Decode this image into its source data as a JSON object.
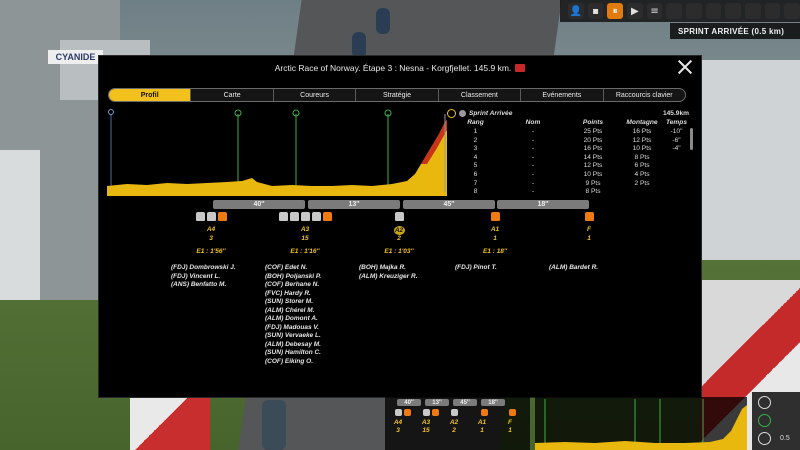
{
  "background": {
    "sign_text": "CYANIDE"
  },
  "hud": {
    "status_text": "SPRINT ARRIVÉE (0.5 km)",
    "buttons": [
      "👤",
      "▪",
      "⏸",
      "▶",
      "≡"
    ]
  },
  "modal": {
    "title": "Arctic Race of Norway. Étape 3 : Nesna - Korgfjellet. 145.9 km.",
    "tabs": [
      "Profil",
      "Carte",
      "Coureurs",
      "Stratégie",
      "Classement",
      "Evénements",
      "Raccourcis clavier"
    ],
    "active_tab": "Profil"
  },
  "sprint": {
    "label": "Sprint Arrivée",
    "distance": "145.9km",
    "headers": {
      "rank": "Rang",
      "name": "Nom",
      "points": "Points",
      "mountain": "Montagne",
      "time": "Temps"
    },
    "rows": [
      {
        "rank": "1",
        "name": "-",
        "points": "25 Pts",
        "mountain": "16 Pts",
        "time": "-10\""
      },
      {
        "rank": "2",
        "name": "-",
        "points": "20 Pts",
        "mountain": "12 Pts",
        "time": "-6\""
      },
      {
        "rank": "3",
        "name": "-",
        "points": "16 Pts",
        "mountain": "10 Pts",
        "time": "-4\""
      },
      {
        "rank": "4",
        "name": "-",
        "points": "14 Pts",
        "mountain": "8 Pts",
        "time": ""
      },
      {
        "rank": "5",
        "name": "-",
        "points": "12 Pts",
        "mountain": "6 Pts",
        "time": ""
      },
      {
        "rank": "6",
        "name": "-",
        "points": "10 Pts",
        "mountain": "4 Pts",
        "time": ""
      },
      {
        "rank": "7",
        "name": "-",
        "points": "9 Pts",
        "mountain": "2 Pts",
        "time": ""
      },
      {
        "rank": "8",
        "name": "-",
        "points": "8 Pts",
        "mountain": "",
        "time": ""
      }
    ]
  },
  "gaps": [
    "40''",
    "13''",
    "45''",
    "18''"
  ],
  "groups": [
    {
      "code": "A4",
      "count": "3",
      "gap": "E1 : 1'56''",
      "riders": [
        "(FDJ) Dombrowski J.",
        "(FDJ) Vincent L.",
        "(ANS) Benfatto M."
      ]
    },
    {
      "code": "A3",
      "count": "15",
      "gap": "E1 : 1'16''",
      "riders": [
        "(COF) Edet N.",
        "(BOH) Poljanski P.",
        "(COF) Berhane N.",
        "(FVC) Hardy R.",
        "(SUN) Storer M.",
        "(ALM) Chérel M.",
        "(ALM) Domont A.",
        "(FDJ) Madouas V.",
        "(SUN) Vervaeke L.",
        "(ALM) Debesay M.",
        "(SUN) Hamilton C.",
        "(COF) Eiking O."
      ]
    },
    {
      "code": "A2",
      "count": "2",
      "gap": "E1 : 1'03''",
      "riders": [
        "(BOH) Majka R.",
        "(ALM) Kreuziger R."
      ]
    },
    {
      "code": "A1",
      "count": "1",
      "gap": "E1 : 18''",
      "riders": [
        "(FDJ) Pinot T."
      ]
    },
    {
      "code": "F",
      "count": "1",
      "gap": "",
      "riders": [
        "(ALM) Bardet R."
      ]
    }
  ],
  "mini": {
    "gaps": [
      "40''",
      "13''",
      "45''",
      "18''"
    ],
    "codes": [
      "A4",
      "A3",
      "A2",
      "A1",
      "F"
    ],
    "counts": [
      "3",
      "15",
      "2",
      "1",
      "1"
    ],
    "speed": "0.5"
  },
  "colors": {
    "accent": "#f2c11d",
    "jersey_orange": "#ee7a14",
    "jersey_white": "#c8c8c8",
    "sprint_line": "#3cb043",
    "profile_fill": "#e8b80e"
  }
}
